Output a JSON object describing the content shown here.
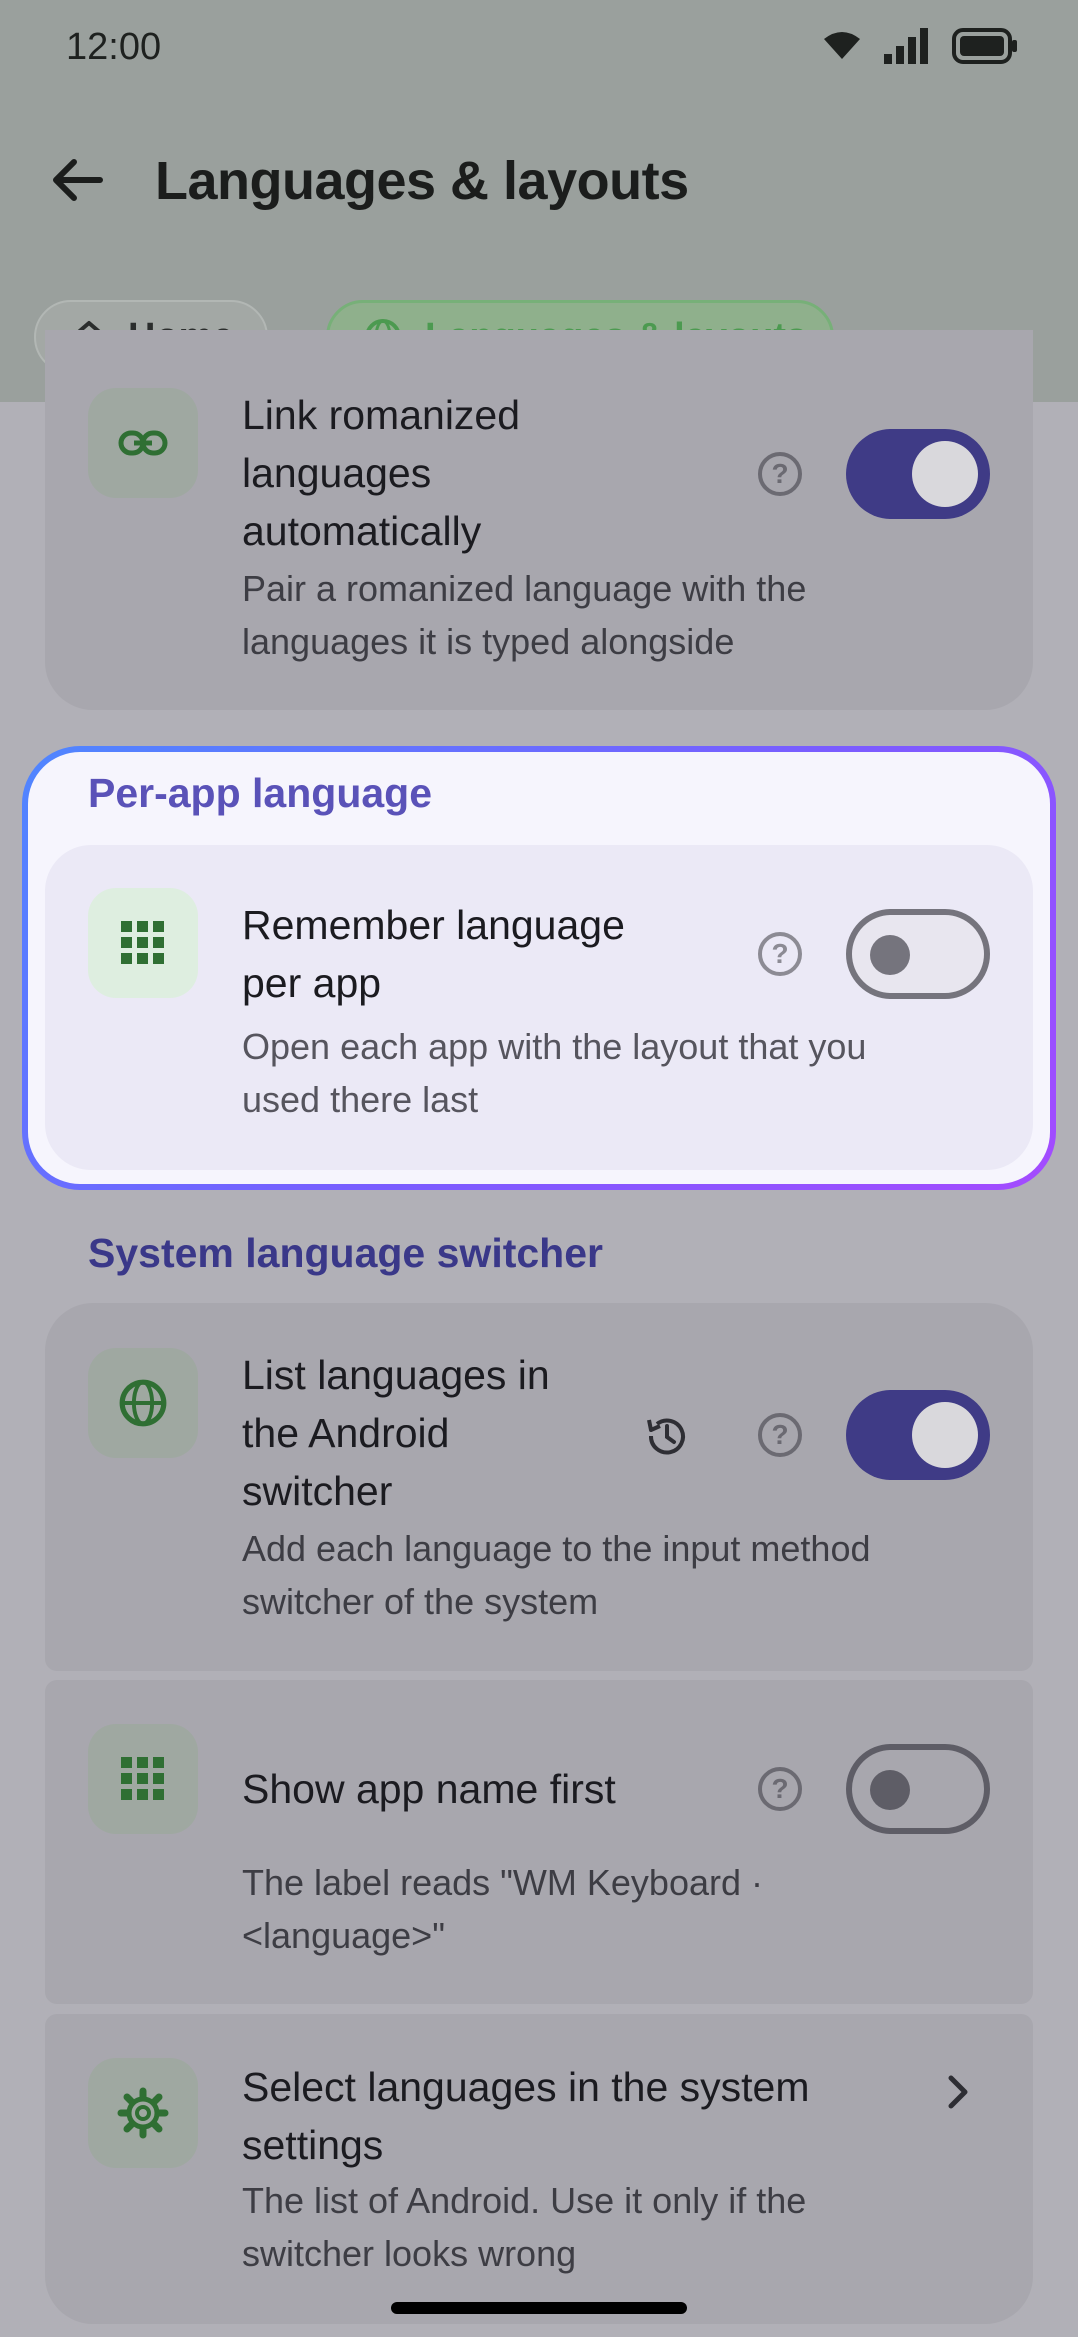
{
  "status": {
    "time": "12:00",
    "icons": [
      "wifi-icon",
      "signal-icon",
      "battery-icon"
    ]
  },
  "app_bar": {
    "title": "Languages & layouts",
    "back_icon": "arrow-left-icon"
  },
  "breadcrumb": {
    "home": "Home",
    "current": "Languages & layouts"
  },
  "settings": {
    "link_romanized": {
      "title_lines": [
        "Link romanized",
        "languages",
        "automatically"
      ],
      "desc_lines": [
        "Pair a romanized language with the",
        "languages it is typed alongside"
      ],
      "enabled": true
    },
    "per_app_section": "Per-app language",
    "remember_language": {
      "title_lines": [
        "Remember language",
        "per app"
      ],
      "desc_lines": [
        "Open each app with the layout that you",
        "used there last"
      ],
      "enabled": false
    },
    "system_switcher_section": "System language switcher",
    "list_in_android": {
      "title_lines": [
        "List languages in",
        "the Android",
        "switcher"
      ],
      "desc_lines": [
        "Add each language to the input method",
        "switcher of the system"
      ],
      "enabled": true
    },
    "show_app_name_first": {
      "title": "Show app name first",
      "desc_lines": [
        "The label reads \"WM Keyboard ·",
        "<language>\""
      ],
      "enabled": false
    },
    "select_in_system": {
      "title_lines": [
        "Select languages in the system",
        "settings"
      ],
      "desc_lines": [
        "The list of Android. Use it only if the",
        "switcher looks wrong"
      ]
    }
  },
  "colors": {
    "accent": "#3f3b86",
    "green": "#4c9a50",
    "highlight_start": "#4f86ff",
    "highlight_end": "#a44bff"
  }
}
